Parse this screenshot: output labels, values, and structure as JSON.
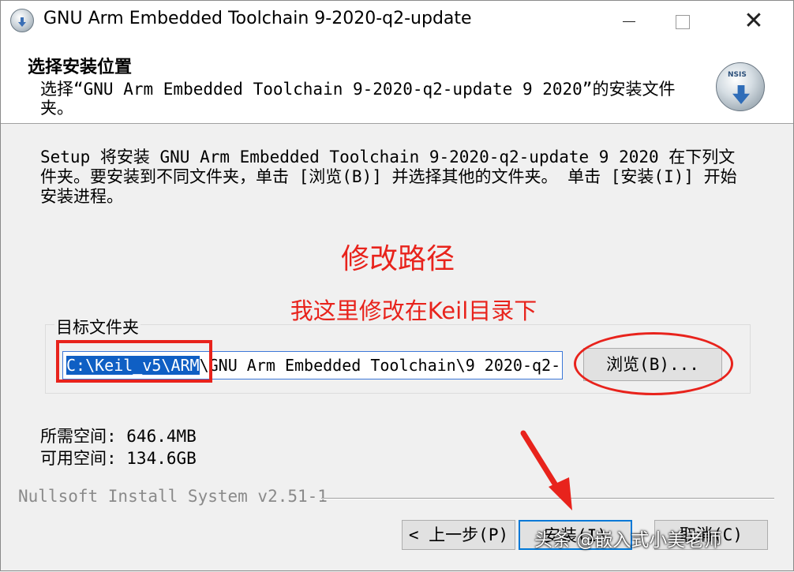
{
  "window": {
    "title": "GNU Arm Embedded Toolchain 9-2020-q2-update",
    "minimize": "",
    "maximize": "",
    "close": "✕"
  },
  "header": {
    "title": "选择安装位置",
    "description": "选择“GNU Arm Embedded Toolchain 9-2020-q2-update 9 2020”的安装文件夹。",
    "icon": "nsis-installer-icon",
    "icon_text": "NSIS"
  },
  "body": {
    "instructions": "Setup 将安装 GNU Arm Embedded Toolchain 9-2020-q2-update 9 2020 在下列文件夹。要安装到不同文件夹，单击 [浏览(B)] 并选择其他的文件夹。 单击 [安装(I)] 开始安装进程。",
    "annotation_title": "修改路径",
    "annotation_subtitle": "我这里修改在Keil目录下",
    "group_label": "目标文件夹",
    "path_selected": "C:\\Keil_v5\\ARM",
    "path_rest": "\\GNU Arm Embedded Toolchain\\9 2020-q2-",
    "browse_label": "浏览(B)...",
    "space_required": "所需空间: 646.4MB",
    "space_available": "可用空间: 134.6GB"
  },
  "footer": {
    "brand": "Nullsoft Install System v2.51-1",
    "back_label": "< 上一步(P)",
    "install_label": "安装(I)",
    "cancel_label": "取消(C)"
  },
  "watermark": "头条 @嵌入式小美老师",
  "colors": {
    "annotation_red": "#e8231c",
    "selection_blue": "#0f5fc4",
    "focus_blue": "#0078d7"
  }
}
